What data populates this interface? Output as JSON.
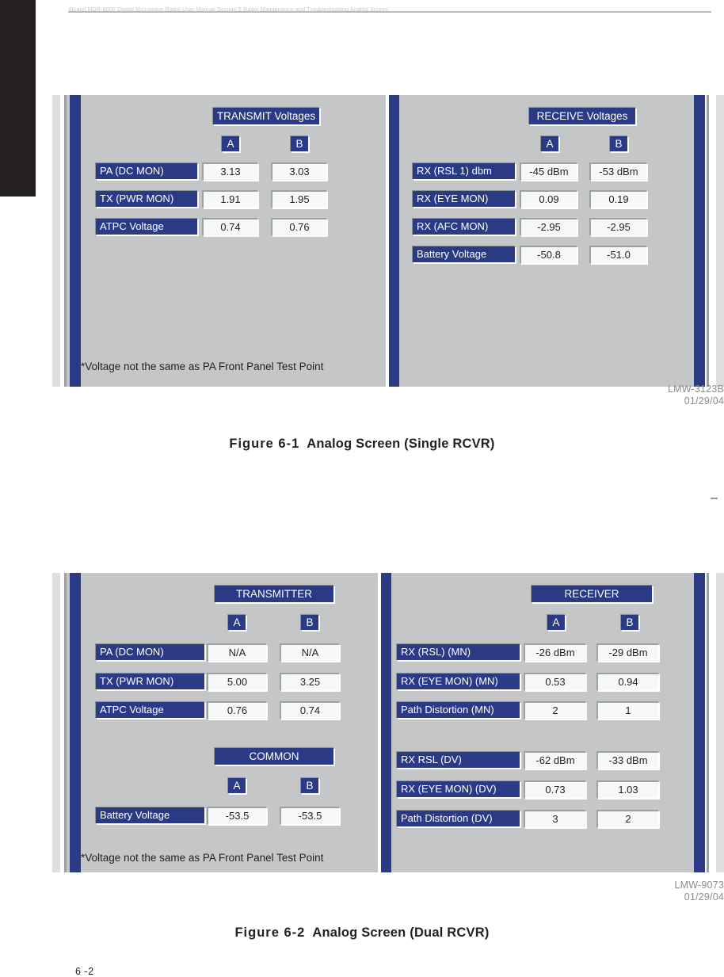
{
  "page": {
    "number": "6 -2",
    "header_ghost": "Alcatel  MDR-8000 Digital Microwave Radio  User Manual  Section 6  Radio Maintenance and Troubleshooting  Analog Screen"
  },
  "figure1": {
    "id": "LMW-3123B",
    "date": "01/29/04",
    "caption_number": "Figure 6-1",
    "caption_title": "Analog Screen (Single RCVR)",
    "left_panel": {
      "title": "TRANSMIT Voltages",
      "columns": [
        "A",
        "B"
      ],
      "rows": [
        {
          "label": "PA (DC MON)",
          "a": "3.13",
          "b": "3.03"
        },
        {
          "label": "TX (PWR MON)",
          "a": "1.91",
          "b": "1.95"
        },
        {
          "label": "ATPC Voltage",
          "a": "0.74",
          "b": "0.76"
        }
      ],
      "footnote": "*Voltage not the same as PA Front Panel Test Point"
    },
    "right_panel": {
      "title": "RECEIVE Voltages",
      "columns": [
        "A",
        "B"
      ],
      "rows": [
        {
          "label": "RX (RSL 1) dbm",
          "a": "-45 dBm",
          "b": "-53 dBm"
        },
        {
          "label": "RX (EYE MON)",
          "a": "0.09",
          "b": "0.19"
        },
        {
          "label": "RX (AFC MON)",
          "a": "-2.95",
          "b": "-2.95"
        },
        {
          "label": "Battery Voltage",
          "a": "-50.8",
          "b": "-51.0"
        }
      ]
    }
  },
  "figure2": {
    "id": "LMW-9073",
    "date": "01/29/04",
    "caption_number": "Figure 6-2",
    "caption_title": "Analog Screen (Dual RCVR)",
    "left_panel": {
      "title": "TRANSMITTER",
      "columns": [
        "A",
        "B"
      ],
      "rows": [
        {
          "label": "PA (DC MON)",
          "a": "N/A",
          "b": "N/A"
        },
        {
          "label": "TX (PWR MON)",
          "a": "5.00",
          "b": "3.25"
        },
        {
          "label": "ATPC Voltage",
          "a": "0.76",
          "b": "0.74"
        }
      ],
      "common_title": "COMMON",
      "common_columns": [
        "A",
        "B"
      ],
      "common_rows": [
        {
          "label": "Battery Voltage",
          "a": "-53.5",
          "b": "-53.5"
        }
      ],
      "footnote": "*Voltage not the same as PA Front Panel Test Point"
    },
    "right_panel": {
      "title": "RECEIVER",
      "columns": [
        "A",
        "B"
      ],
      "rows_mn": [
        {
          "label": "RX (RSL) (MN)",
          "a": "-26 dBm",
          "b": "-29 dBm"
        },
        {
          "label": "RX (EYE MON) (MN)",
          "a": "0.53",
          "b": "0.94"
        },
        {
          "label": "Path Distortion (MN)",
          "a": "2",
          "b": "1"
        }
      ],
      "rows_dv": [
        {
          "label": "RX RSL (DV)",
          "a": "-62 dBm",
          "b": "-33 dBm"
        },
        {
          "label": "RX (EYE MON) (DV)",
          "a": "0.73",
          "b": "1.03"
        },
        {
          "label": "Path Distortion (DV)",
          "a": "3",
          "b": "2"
        }
      ]
    }
  },
  "colors": {
    "chip_blue": "#2b3a85",
    "panel_gray": "#c4c6c8",
    "rail_gray": "#dcdedf",
    "value_fill": "#f7f8f8"
  }
}
